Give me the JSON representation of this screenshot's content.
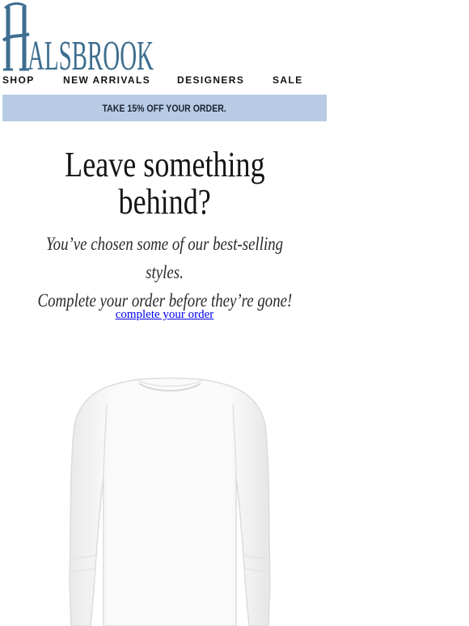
{
  "brand": {
    "logo_text": "HALSBROOK",
    "color": "#3d6e8f"
  },
  "nav": {
    "items": [
      "SHOP",
      "NEW ARRIVALS",
      "DESIGNERS",
      "SALE"
    ]
  },
  "promo": {
    "text": "TAKE 15% OFF YOUR ORDER.",
    "background": "#b7cbe4"
  },
  "hero": {
    "headline_line1": "Leave something",
    "headline_line2": "behind?",
    "subtext_line1": "You’ve chosen some of our best-selling styles.",
    "subtext_line2": "Complete your order before they’re gone!",
    "cta_label": "complete your order"
  },
  "product": {
    "image": "white-long-sleeve-top"
  }
}
